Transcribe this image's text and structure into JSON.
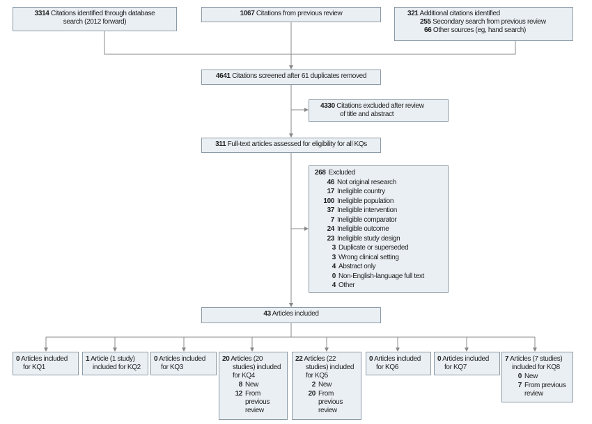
{
  "sources": [
    {
      "count": "3314",
      "label": "Citations identified through database",
      "label2": "search (2012 forward)"
    },
    {
      "count": "1067",
      "label": "Citations from previous review"
    },
    {
      "count": "321",
      "label": "Additional citations identified",
      "sub": [
        {
          "count": "255",
          "label": "Secondary search from previous review"
        },
        {
          "count": "66",
          "label": "Other sources (eg, hand search)"
        }
      ]
    }
  ],
  "screened": {
    "count": "4641",
    "label": "Citations screened after 61 duplicates removed"
  },
  "excluded_title": {
    "count": "4330",
    "label": "Citations excluded after review",
    "label2": "of title and abstract"
  },
  "fulltext": {
    "count": "311",
    "label": "Full-text articles assessed for eligibility for all KQs"
  },
  "excluded_fulltext": {
    "count": "268",
    "label": "Excluded",
    "reasons": [
      {
        "count": "46",
        "label": "Not original research"
      },
      {
        "count": "17",
        "label": "Ineligible country"
      },
      {
        "count": "100",
        "label": "Ineligible population"
      },
      {
        "count": "37",
        "label": "Ineligible intervention"
      },
      {
        "count": "7",
        "label": "Ineligible comparator"
      },
      {
        "count": "24",
        "label": "Ineligible outcome"
      },
      {
        "count": "23",
        "label": "Ineligible study design"
      },
      {
        "count": "3",
        "label": "Duplicate or superseded"
      },
      {
        "count": "3",
        "label": "Wrong clinical setting"
      },
      {
        "count": "4",
        "label": "Abstract only"
      },
      {
        "count": "0",
        "label": "Non-English-language full text"
      },
      {
        "count": "4",
        "label": "Other"
      }
    ]
  },
  "included": {
    "count": "43",
    "label": "Articles included"
  },
  "kq": [
    {
      "count": "0",
      "label": "Articles included",
      "label2": "for KQ1"
    },
    {
      "count": "1",
      "label": "Article (1 study)",
      "label2": "included for KQ2"
    },
    {
      "count": "0",
      "label": "Articles included",
      "label2": "for KQ3"
    },
    {
      "count": "20",
      "label": "Articles (20",
      "label2": "studies) included",
      "label3": "for KQ4",
      "sub": [
        {
          "count": "8",
          "label": "New"
        },
        {
          "count": "12",
          "label": "From previous review"
        }
      ]
    },
    {
      "count": "22",
      "label": "Articles (22",
      "label2": "studies) included",
      "label3": "for KQ5",
      "sub": [
        {
          "count": "2",
          "label": "New"
        },
        {
          "count": "20",
          "label": "From previous review"
        }
      ]
    },
    {
      "count": "0",
      "label": "Articles included",
      "label2": "for KQ6"
    },
    {
      "count": "0",
      "label": "Articles included",
      "label2": "for KQ7"
    },
    {
      "count": "7",
      "label": "Articles (7 studies)",
      "label2": "included for KQ8",
      "sub": [
        {
          "count": "0",
          "label": "New"
        },
        {
          "count": "7",
          "label": "From previous review"
        }
      ]
    }
  ],
  "colors": {
    "box_fill": "#e9eff3",
    "box_border": "#8c9aa6",
    "line": "#888888"
  }
}
